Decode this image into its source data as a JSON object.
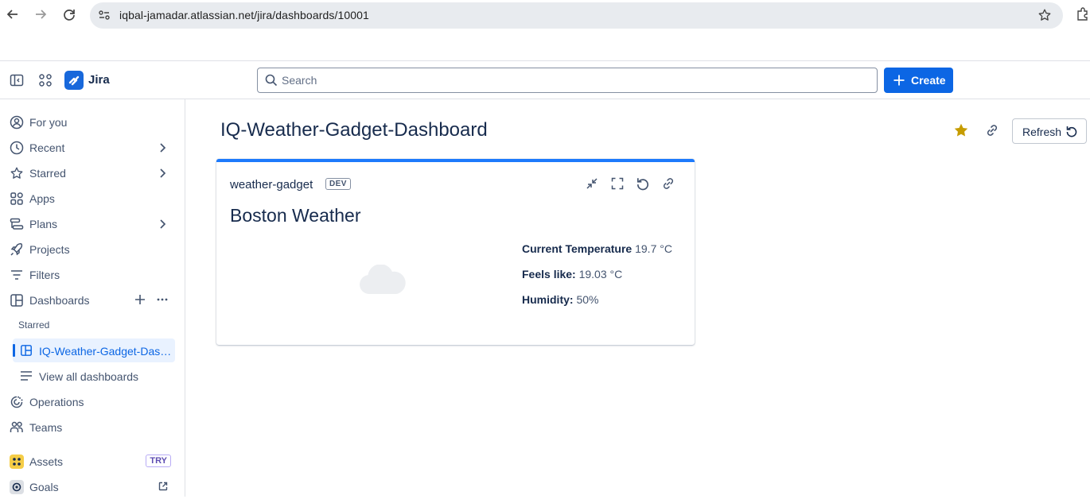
{
  "browser": {
    "url": "iqbal-jamadar.atlassian.net/jira/dashboards/10001"
  },
  "topbar": {
    "app_name": "Jira",
    "search_placeholder": "Search",
    "create_label": "Create"
  },
  "sidebar": {
    "items": [
      {
        "label": "For you",
        "icon": "person-circle-icon",
        "chevron": false
      },
      {
        "label": "Recent",
        "icon": "clock-icon",
        "chevron": true
      },
      {
        "label": "Starred",
        "icon": "star-outline-icon",
        "chevron": true
      },
      {
        "label": "Apps",
        "icon": "apps-grid-icon",
        "chevron": false
      },
      {
        "label": "Plans",
        "icon": "plans-icon",
        "chevron": true
      },
      {
        "label": "Projects",
        "icon": "rocket-icon",
        "chevron": false
      },
      {
        "label": "Filters",
        "icon": "filter-icon",
        "chevron": false
      }
    ],
    "dashboards_label": "Dashboards",
    "starred_section_label": "Starred",
    "active_dashboard": "IQ-Weather-Gadget-Dashboard",
    "view_all_label": "View all dashboards",
    "operations_label": "Operations",
    "teams_label": "Teams",
    "assets_label": "Assets",
    "assets_badge": "TRY",
    "goals_label": "Goals"
  },
  "main": {
    "title": "IQ-Weather-Gadget-Dashboard",
    "refresh_label": "Refresh",
    "star_color": "#c69c00"
  },
  "gadget": {
    "name": "weather-gadget",
    "badge": "DEV",
    "heading": "Boston Weather",
    "icon": "cloud-icon",
    "rows": [
      {
        "label": "Current Temperature",
        "value": "19.7 °C"
      },
      {
        "label": "Feels like:",
        "value": "19.03 °C"
      },
      {
        "label": "Humidity:",
        "value": "50%"
      }
    ],
    "accent_color": "#1d7afc"
  }
}
